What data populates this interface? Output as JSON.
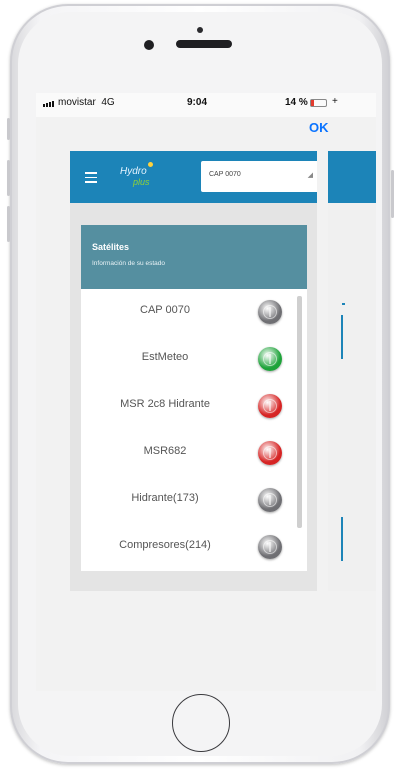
{
  "status_bar": {
    "carrier": "movistar",
    "network": "4G",
    "time": "9:04",
    "battery": "14 %",
    "charging_icon": "+"
  },
  "nav": {
    "ok_label": "OK"
  },
  "app": {
    "logo": {
      "top": "Hydro",
      "bottom": "plus"
    },
    "selected_satellite": "CAP 0070",
    "menu_icon": "hamburger-icon",
    "header_color": "#1c84b8"
  },
  "card": {
    "title": "Satélites",
    "subtitle": "Información de su estado",
    "header_color": "#558fa0"
  },
  "satellites": [
    {
      "name": "CAP 0070",
      "status": "gray",
      "color": "#6f6f73"
    },
    {
      "name": "EstMeteo",
      "status": "green",
      "color": "#1ea33a"
    },
    {
      "name": "MSR 2c8 Hidrante",
      "status": "red",
      "color": "#d62424"
    },
    {
      "name": "MSR682",
      "status": "red",
      "color": "#d62424"
    },
    {
      "name": "Hidrante(173)",
      "status": "gray",
      "color": "#6f6f73"
    },
    {
      "name": "Compresores(214)",
      "status": "gray",
      "color": "#6f6f73"
    }
  ]
}
